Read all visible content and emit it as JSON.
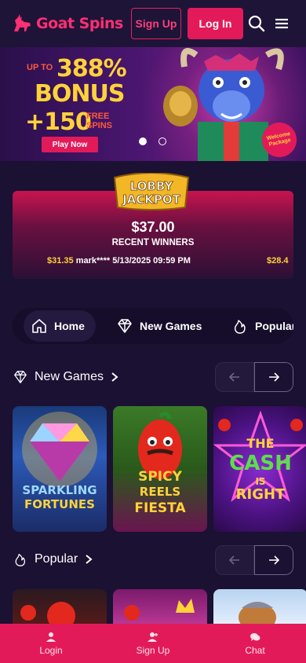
{
  "header": {
    "logo_text": "Goat Spins",
    "signup_label": "Sign Up",
    "login_label": "Log In"
  },
  "banner": {
    "up_to": "UP TO",
    "percent": "388%",
    "bonus": "BONUS",
    "plus_spins": "+150",
    "free_spins": "FREE SPINS",
    "play_label": "Play Now",
    "badge": "Welcome Package",
    "slides": 2,
    "active_slide": 1
  },
  "jackpot": {
    "logo_line1": "LOBBY",
    "logo_line2": "JACKPOT",
    "amount": "$37.00",
    "recent_label": "RECENT WINNERS",
    "ticker_amount": "$31.35",
    "ticker_text": "mark**** 5/13/2025 09:59 PM",
    "ticker_next": "$28.4"
  },
  "tabs": [
    {
      "label": "Home",
      "icon": "home-icon",
      "active": true
    },
    {
      "label": "New Games",
      "icon": "diamond-icon",
      "active": false
    },
    {
      "label": "Popular",
      "icon": "flame-icon",
      "active": false
    }
  ],
  "sections": {
    "new_games": {
      "title": "New Games"
    },
    "popular": {
      "title": "Popular"
    }
  },
  "new_games": [
    {
      "line1": "SPARKLING",
      "line2": "FORTUNES"
    },
    {
      "line1": "SPICY",
      "line2": "REELS",
      "line3": "FIESTA"
    },
    {
      "line1": "THE",
      "line2": "CASH",
      "line3": "IS",
      "line4": "RIGHT"
    }
  ],
  "bottom_nav": [
    {
      "label": "Login",
      "icon": "user-icon"
    },
    {
      "label": "Sign Up",
      "icon": "user-plus-icon"
    },
    {
      "label": "Chat",
      "icon": "chat-icon"
    }
  ],
  "colors": {
    "background": "#1a1133",
    "accent": "#e31a5a",
    "gold": "#ffd23a"
  }
}
